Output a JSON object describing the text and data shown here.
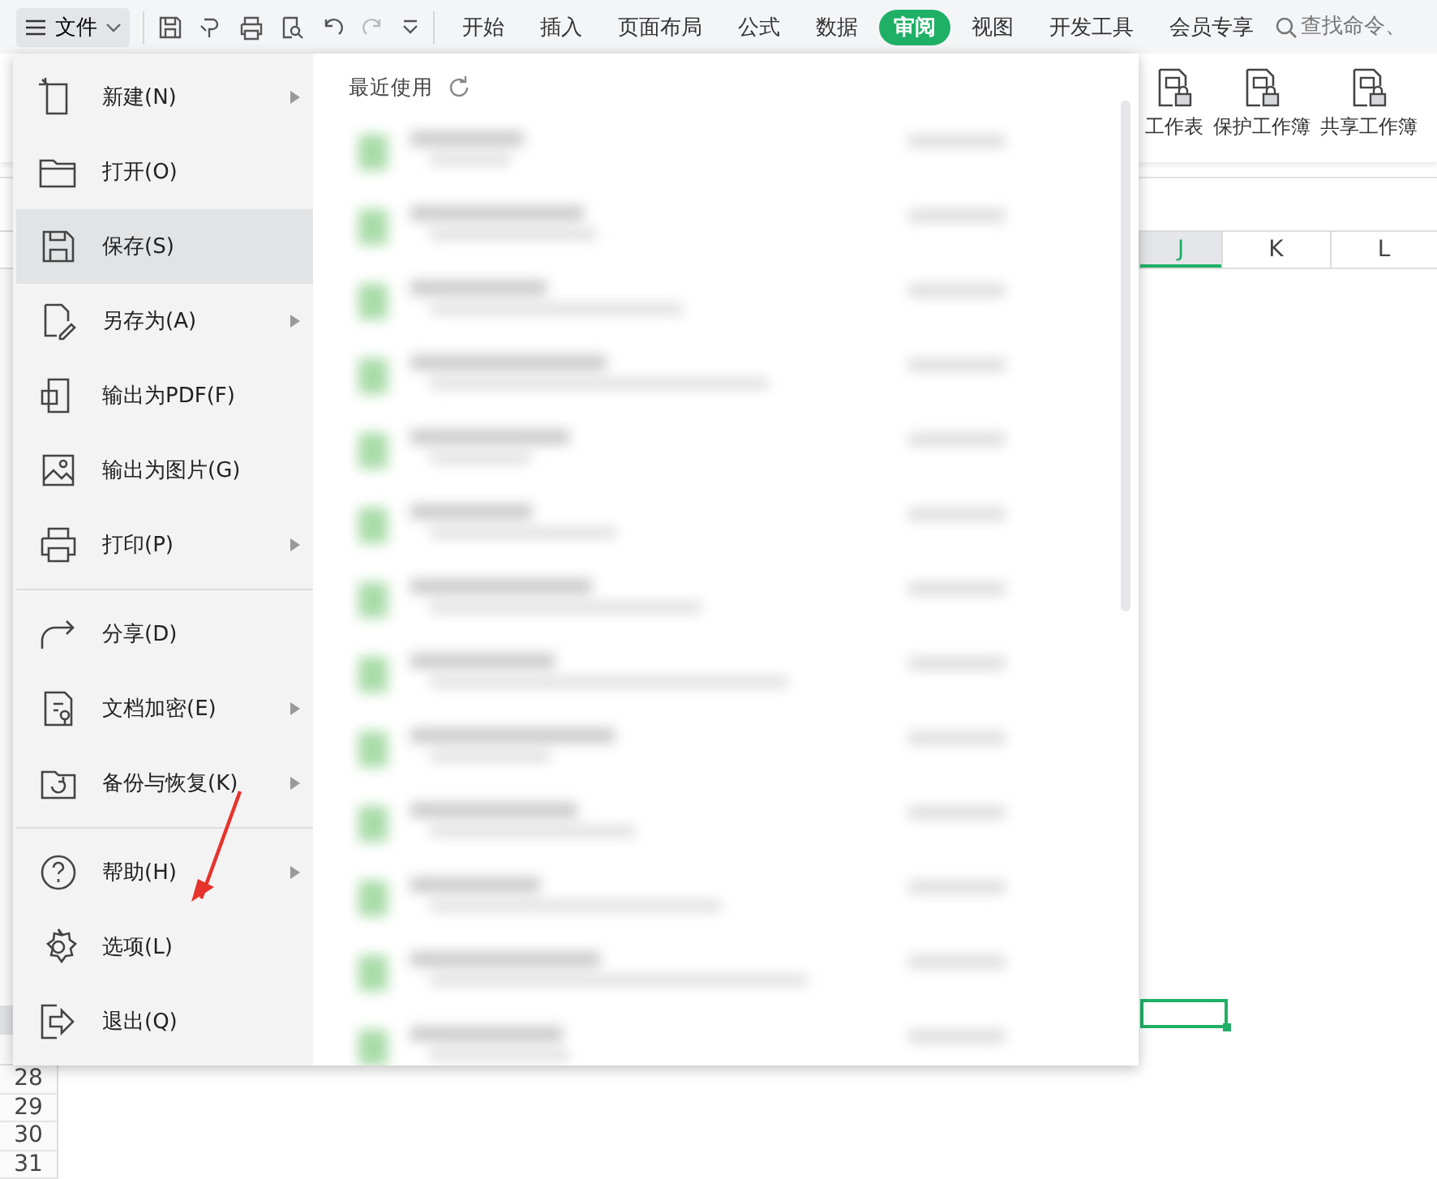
{
  "toolbar": {
    "file_button": "文件",
    "tabs": [
      {
        "label": "开始",
        "selected": false
      },
      {
        "label": "插入",
        "selected": false
      },
      {
        "label": "页面布局",
        "selected": false
      },
      {
        "label": "公式",
        "selected": false
      },
      {
        "label": "数据",
        "selected": false
      },
      {
        "label": "审阅",
        "selected": true
      },
      {
        "label": "视图",
        "selected": false
      },
      {
        "label": "开发工具",
        "selected": false
      },
      {
        "label": "会员专享",
        "selected": false
      }
    ],
    "search": {
      "placeholder": "查找命令、"
    }
  },
  "ribbon": {
    "items": [
      "工作表",
      "保护工作簿",
      "共享工作簿"
    ]
  },
  "column_headers": [
    {
      "label": "J",
      "selected": true
    },
    {
      "label": "K",
      "selected": false
    },
    {
      "label": "L",
      "selected": false
    }
  ],
  "row_headers": [
    "28",
    "29",
    "30",
    "31"
  ],
  "file_menu": {
    "sections": [
      [
        {
          "label": "新建(N)",
          "submenu": true,
          "selected": false
        },
        {
          "label": "打开(O)",
          "submenu": false,
          "selected": false
        },
        {
          "label": "保存(S)",
          "submenu": false,
          "selected": true
        },
        {
          "label": "另存为(A)",
          "submenu": true,
          "selected": false
        },
        {
          "label": "输出为PDF(F)",
          "submenu": false,
          "selected": false
        },
        {
          "label": "输出为图片(G)",
          "submenu": false,
          "selected": false
        },
        {
          "label": "打印(P)",
          "submenu": true,
          "selected": false
        }
      ],
      [
        {
          "label": "分享(D)",
          "submenu": false,
          "selected": false
        },
        {
          "label": "文档加密(E)",
          "submenu": true,
          "selected": false
        },
        {
          "label": "备份与恢复(K)",
          "submenu": true,
          "selected": false
        }
      ],
      [
        {
          "label": "帮助(H)",
          "submenu": true,
          "selected": false
        },
        {
          "label": "选项(L)",
          "submenu": false,
          "selected": false
        },
        {
          "label": "退出(Q)",
          "submenu": false,
          "selected": false
        }
      ]
    ],
    "recent_title": "最近使用"
  }
}
